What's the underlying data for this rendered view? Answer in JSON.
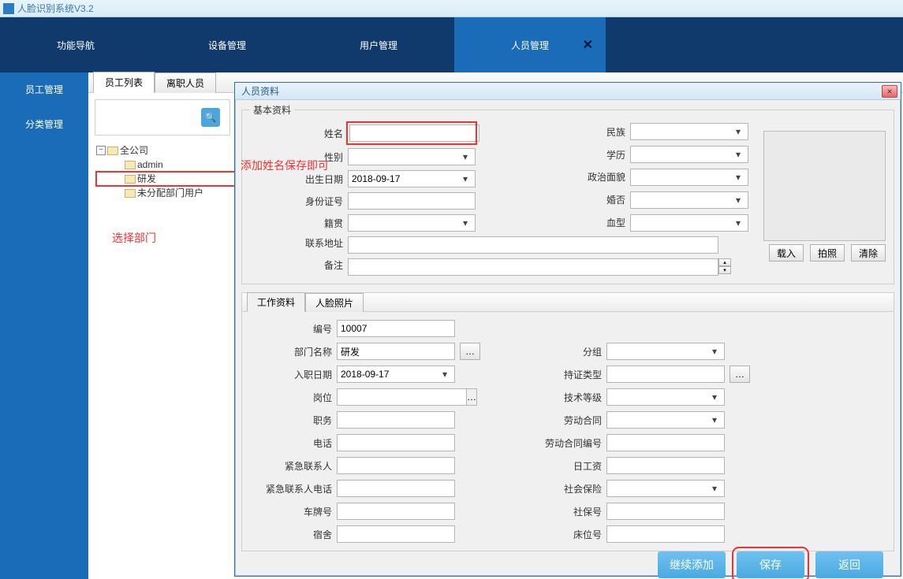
{
  "window_title": "人脸识别系统V3.2",
  "topnav": {
    "items": [
      "功能导航",
      "设备管理",
      "用户管理",
      "人员管理"
    ],
    "active_index": 3
  },
  "leftnav": {
    "items": [
      "员工管理",
      "分类管理"
    ],
    "active_index": 0
  },
  "content_tabs": {
    "items": [
      "员工列表",
      "离职人员"
    ],
    "active_index": 0
  },
  "tree": {
    "root": "全公司",
    "children": [
      "admin",
      "研发",
      "未分配部门用户"
    ]
  },
  "annotations": {
    "add_name_hint": "添加姓名保存即可",
    "select_dept_hint": "选择部门"
  },
  "dialog": {
    "title": "人员资料",
    "basic_legend": "基本资料",
    "labels": {
      "name": "姓名",
      "gender": "性别",
      "birth": "出生日期",
      "idno": "身份证号",
      "origin": "籍贯",
      "address": "联系地址",
      "remark": "备注",
      "nation": "民族",
      "edu": "学历",
      "politics": "政治面貌",
      "marital": "婚否",
      "blood": "血型"
    },
    "values": {
      "name": "",
      "gender": "",
      "birth": "2018-09-17",
      "idno": "",
      "origin": "",
      "address": "",
      "remark": "",
      "nation": "",
      "edu": "",
      "politics": "",
      "marital": "",
      "blood": ""
    },
    "photo_buttons": {
      "load": "载入",
      "capture": "拍照",
      "clear": "清除"
    },
    "lower_tabs": {
      "items": [
        "工作资料",
        "人脸照片"
      ],
      "active_index": 0
    },
    "work": {
      "labels": {
        "emp_no": "编号",
        "dept": "部门名称",
        "hire_date": "入职日期",
        "post": "岗位",
        "position": "职务",
        "phone": "电话",
        "emergency_contact": "紧急联系人",
        "emergency_phone": "紧急联系人电话",
        "car_plate": "车牌号",
        "dorm": "宿舍",
        "group": "分组",
        "cert_type": "持证类型",
        "tech_level": "技术等级",
        "labor_contract": "劳动合同",
        "labor_contract_no": "劳动合同编号",
        "daily_wage": "日工资",
        "social_ins": "社会保险",
        "social_no": "社保号",
        "bed_no": "床位号"
      },
      "values": {
        "emp_no": "10007",
        "dept": "研发",
        "hire_date": "2018-09-17",
        "post": "",
        "position": "",
        "phone": "",
        "emergency_contact": "",
        "emergency_phone": "",
        "car_plate": "",
        "dorm": "",
        "group": "",
        "cert_type": "",
        "tech_level": "",
        "labor_contract": "",
        "labor_contract_no": "",
        "daily_wage": "",
        "social_ins": "",
        "social_no": "",
        "bed_no": ""
      }
    },
    "footer": {
      "continue_add": "继续添加",
      "save": "保存",
      "back": "返回"
    }
  }
}
